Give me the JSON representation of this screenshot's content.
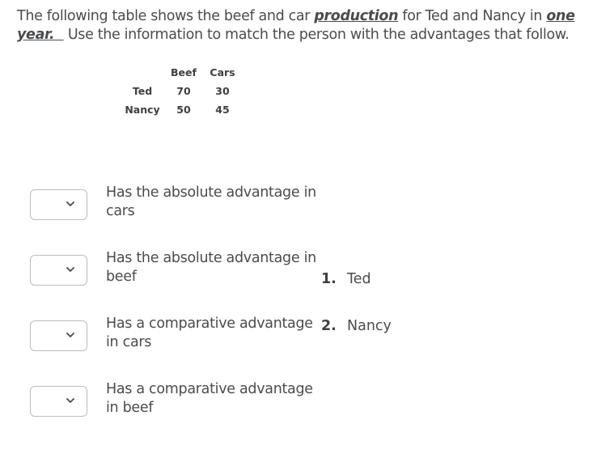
{
  "intro": {
    "part1": "The following table shows the beef and car ",
    "emph1": "production",
    "part2": " for Ted and Nancy in ",
    "emph2": "one year.",
    "gap": "  ",
    "part3": "Use the information to match the person with the advantages that follow."
  },
  "table": {
    "headers": [
      "",
      "Beef",
      "Cars"
    ],
    "rows": [
      {
        "name": "Ted",
        "beef": "70",
        "cars": "30"
      },
      {
        "name": "Nancy",
        "beef": "50",
        "cars": "45"
      }
    ]
  },
  "matches": [
    {
      "label": "Has the absolute advantage in cars",
      "selected": "",
      "icon": "chevron-down-icon"
    },
    {
      "label": "Has the absolute advantage in beef",
      "selected": "",
      "icon": "chevron-down-icon"
    },
    {
      "label": "Has a comparative advantage in cars",
      "selected": "",
      "icon": "chevron-down-icon"
    },
    {
      "label": "Has a comparative advantage in beef",
      "selected": "",
      "icon": "chevron-down-icon"
    }
  ],
  "choices": [
    {
      "number": "1.",
      "label": "Ted"
    },
    {
      "number": "2.",
      "label": "Nancy"
    }
  ]
}
